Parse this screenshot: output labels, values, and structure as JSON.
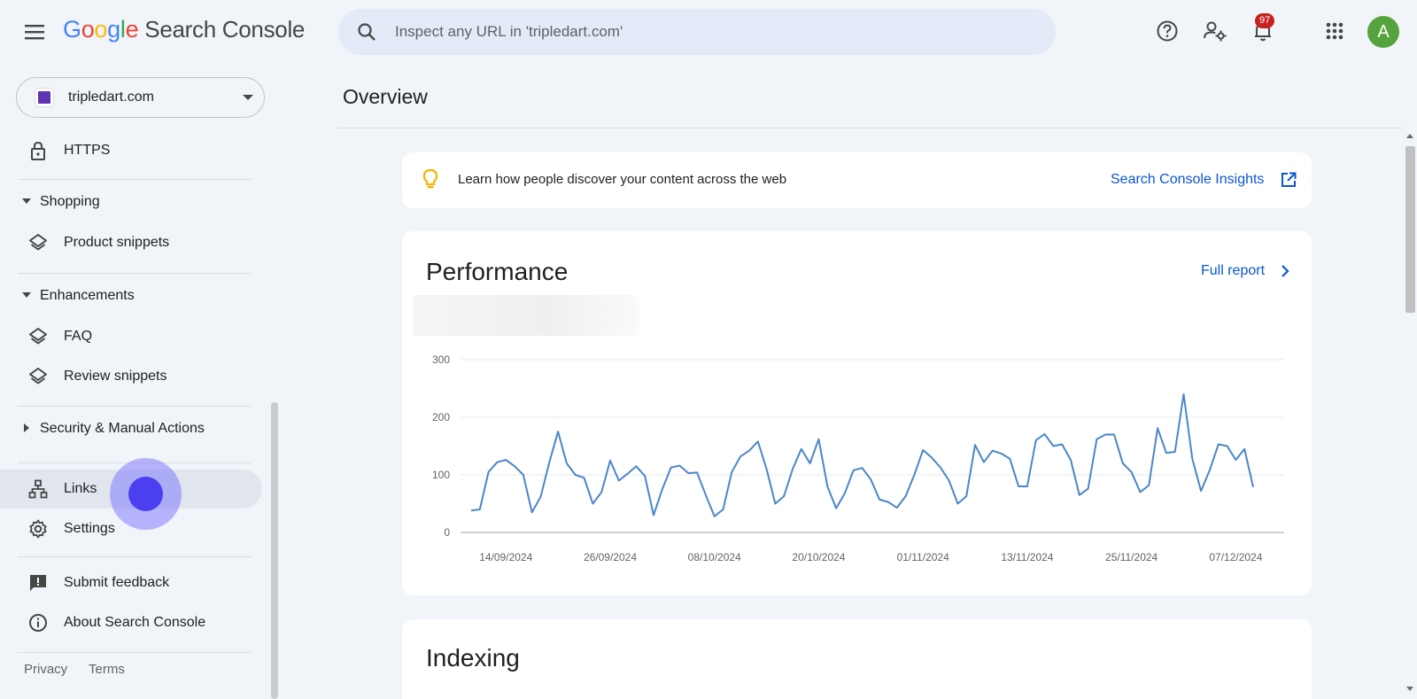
{
  "header": {
    "logo_letters": [
      "G",
      "o",
      "o",
      "g",
      "l",
      "e"
    ],
    "product": "Search Console",
    "search_placeholder": "Inspect any URL in 'tripledart.com'",
    "notifications_count": "97",
    "avatar_letter": "A"
  },
  "sidebar": {
    "property": "tripledart.com",
    "items": [
      {
        "label": "HTTPS",
        "icon": "lock-icon"
      },
      {
        "section": "Shopping"
      },
      {
        "label": "Product snippets",
        "icon": "layers-icon"
      },
      {
        "section": "Enhancements"
      },
      {
        "label": "FAQ",
        "icon": "layers-icon"
      },
      {
        "label": "Review snippets",
        "icon": "layers-icon"
      },
      {
        "section": "Security & Manual Actions"
      },
      {
        "label": "Links",
        "icon": "sitemap-icon"
      },
      {
        "label": "Settings",
        "icon": "gear-icon"
      },
      {
        "label": "Submit feedback",
        "icon": "feedback-icon"
      },
      {
        "label": "About Search Console",
        "icon": "info-icon"
      }
    ],
    "footer": {
      "privacy": "Privacy",
      "terms": "Terms"
    }
  },
  "main": {
    "title": "Overview",
    "insight": {
      "text": "Learn how people discover your content across the web",
      "link": "Search Console Insights"
    },
    "performance": {
      "title": "Performance",
      "link": "Full report"
    },
    "indexing": {
      "title": "Indexing"
    }
  },
  "colors": {
    "accent": "#0b57d0",
    "line": "#4a86c8",
    "background": "#f1f4f9"
  },
  "chart_data": {
    "type": "line",
    "yticks": [
      0,
      100,
      200,
      300
    ],
    "ylim": [
      0,
      300
    ],
    "xticks": [
      "14/09/2024",
      "26/09/2024",
      "08/10/2024",
      "20/10/2024",
      "01/11/2024",
      "13/11/2024",
      "25/11/2024",
      "07/12/2024"
    ],
    "start_date": "2024-09-10",
    "values": [
      38,
      40,
      105,
      122,
      126,
      115,
      100,
      35,
      62,
      122,
      175,
      120,
      100,
      95,
      50,
      70,
      125,
      90,
      102,
      115,
      98,
      30,
      75,
      113,
      116,
      103,
      104,
      65,
      28,
      40,
      105,
      132,
      142,
      158,
      110,
      50,
      63,
      110,
      145,
      120,
      162,
      80,
      42,
      68,
      108,
      112,
      92,
      57,
      53,
      43,
      63,
      100,
      143,
      130,
      113,
      90,
      50,
      63,
      152,
      122,
      142,
      137,
      128,
      80,
      80,
      160,
      171,
      150,
      153,
      126,
      65,
      76,
      162,
      170,
      170,
      120,
      105,
      70,
      82,
      181,
      138,
      140,
      240,
      128,
      72,
      108,
      153,
      150,
      126,
      145,
      79
    ]
  }
}
